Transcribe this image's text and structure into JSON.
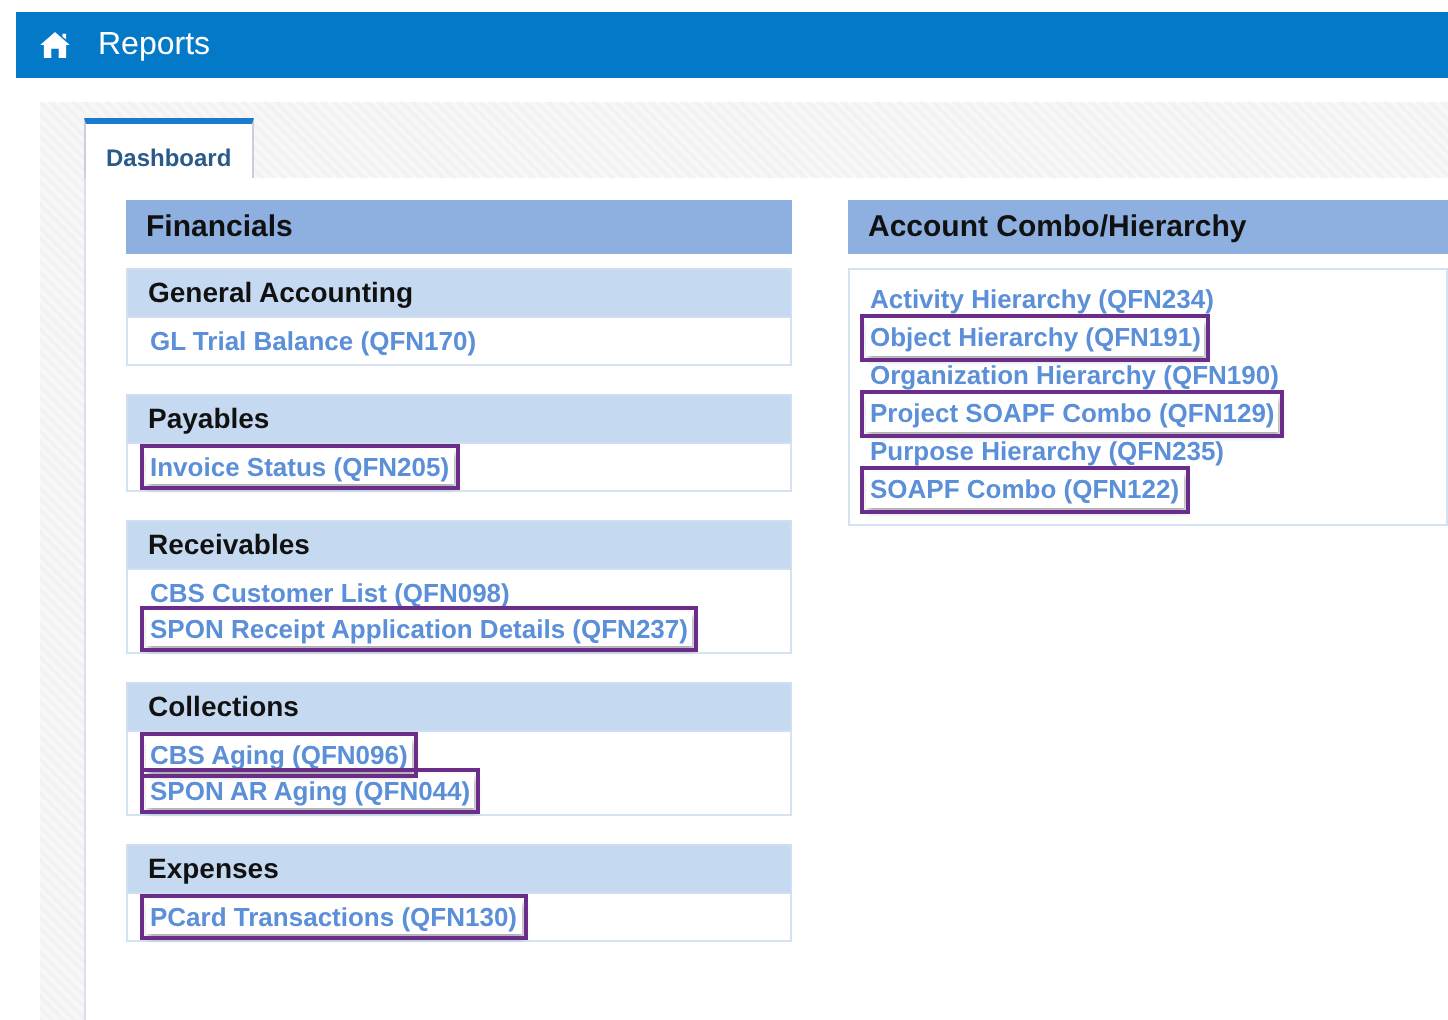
{
  "header": {
    "title": "Reports"
  },
  "tabs": [
    {
      "label": "Dashboard",
      "selected": true
    }
  ],
  "columns": [
    {
      "title": "Financials",
      "groups": [
        {
          "title": "General Accounting",
          "links": [
            {
              "label": "GL Trial Balance (QFN170)",
              "highlighted": false
            }
          ]
        },
        {
          "title": "Payables",
          "links": [
            {
              "label": "Invoice Status (QFN205)",
              "highlighted": true
            }
          ]
        },
        {
          "title": "Receivables",
          "links": [
            {
              "label": "CBS Customer List (QFN098)",
              "highlighted": false
            },
            {
              "label": "SPON Receipt Application Details (QFN237)",
              "highlighted": true
            }
          ]
        },
        {
          "title": "Collections",
          "links": [
            {
              "label": "CBS Aging (QFN096)",
              "highlighted": true
            },
            {
              "label": "SPON AR Aging (QFN044)",
              "highlighted": true
            }
          ]
        },
        {
          "title": "Expenses",
          "links": [
            {
              "label": "PCard Transactions (QFN130)",
              "highlighted": true
            }
          ]
        }
      ]
    },
    {
      "title": "Account Combo/Hierarchy",
      "links": [
        {
          "label": "Activity Hierarchy (QFN234)",
          "highlighted": false
        },
        {
          "label": "Object Hierarchy (QFN191)",
          "highlighted": true
        },
        {
          "label": "Organization Hierarchy (QFN190)",
          "highlighted": false
        },
        {
          "label": "Project SOAPF Combo (QFN129)",
          "highlighted": true
        },
        {
          "label": "Purpose Hierarchy (QFN235)",
          "highlighted": false
        },
        {
          "label": "SOAPF Combo (QFN122)",
          "highlighted": true
        }
      ]
    }
  ]
}
